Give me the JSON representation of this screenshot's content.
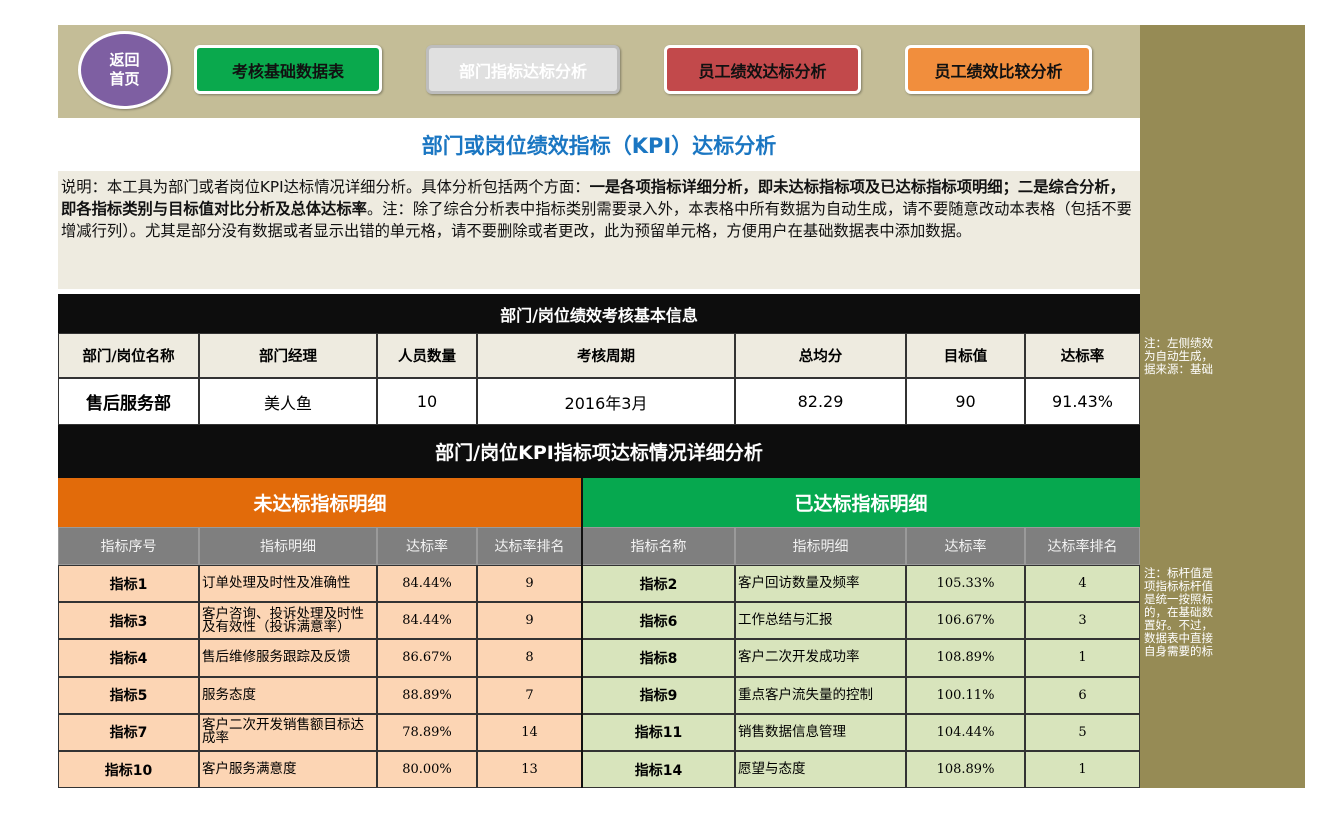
{
  "nav": {
    "home_label": "返回\n首页",
    "buttons": [
      "考核基础数据表",
      "部门指标达标分析",
      "员工绩效达标分析",
      "员工绩效比较分析"
    ]
  },
  "page_title": "部门或岗位绩效指标（KPI）达标分析",
  "description": {
    "part1": "说明：本工具为部门或者岗位KPI达标情况详细分析。具体分析包括两个方面：",
    "bold1": "一是各项指标详细分析，即未达标指标项及已达标指标项明细；二是综合分析，即各指标类别与目标值对比分析及总体达标率",
    "part2": "。注：除了综合分析表中指标类别需要录入外，本表格中所有数据为自动生成，请不要随意改动本表格（包括不要增减行列）。尤其是部分没有数据或者显示出错的单元格，请不要删除或者更改，此为预留单元格，方便用户在基础数据表中添加数据。"
  },
  "basic_info": {
    "title": "部门/岗位绩效考核基本信息",
    "headers": [
      "部门/岗位名称",
      "部门经理",
      "人员数量",
      "考核周期",
      "总均分",
      "目标值",
      "达标率"
    ],
    "values": [
      "售后服务部",
      "美人鱼",
      "10",
      "2016年3月",
      "82.29",
      "90",
      "91.43%"
    ]
  },
  "kpi_section": {
    "title": "部门/岗位KPI指标项达标情况详细分析",
    "unmet_title": "未达标指标明细",
    "met_title": "已达标指标明细",
    "unmet_headers": [
      "指标序号",
      "指标明细",
      "达标率",
      "达标率排名"
    ],
    "met_headers": [
      "指标名称",
      "指标明细",
      "达标率",
      "达标率排名"
    ],
    "unmet_rows": [
      [
        "指标1",
        "订单处理及时性及准确性",
        "84.44%",
        "9"
      ],
      [
        "指标3",
        "客户咨询、投诉处理及时性及有效性（投诉满意率）",
        "84.44%",
        "9"
      ],
      [
        "指标4",
        "售后维修服务跟踪及反馈",
        "86.67%",
        "8"
      ],
      [
        "指标5",
        "服务态度",
        "88.89%",
        "7"
      ],
      [
        "指标7",
        "客户二次开发销售额目标达成率",
        "78.89%",
        "14"
      ],
      [
        "指标10",
        "客户服务满意度",
        "80.00%",
        "13"
      ]
    ],
    "met_rows": [
      [
        "指标2",
        "客户回访数量及频率",
        "105.33%",
        "4"
      ],
      [
        "指标6",
        "工作总结与汇报",
        "106.67%",
        "3"
      ],
      [
        "指标8",
        "客户二次开发成功率",
        "108.89%",
        "1"
      ],
      [
        "指标9",
        "重点客户流失量的控制",
        "100.11%",
        "6"
      ],
      [
        "指标11",
        "销售数据信息管理",
        "104.44%",
        "5"
      ],
      [
        "指标14",
        "愿望与态度",
        "108.89%",
        "1"
      ]
    ]
  },
  "side_notes": {
    "note1": "注：左侧绩效\n为自动生成，\n据来源：基础",
    "note2": "注：标杆值是\n项指标标杆值\n是统一按照标\n的，在基础数\n置好。不过，\n数据表中直接\n自身需要的标"
  }
}
